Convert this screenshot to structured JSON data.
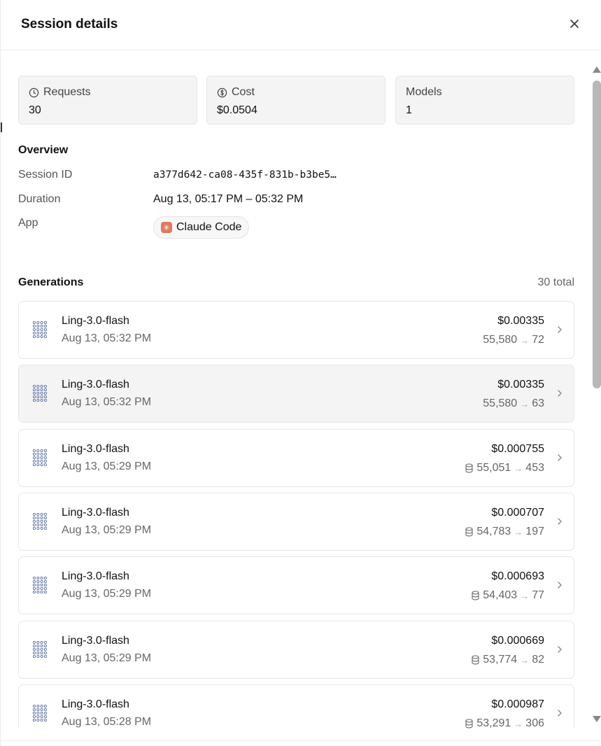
{
  "header": {
    "title": "Session details"
  },
  "stats": [
    {
      "label": "Requests",
      "value": "30",
      "icon": "clock-icon"
    },
    {
      "label": "Cost",
      "value": "$0.0504",
      "icon": "dollar-icon"
    },
    {
      "label": "Models",
      "value": "1",
      "icon": ""
    }
  ],
  "overview": {
    "title": "Overview",
    "session_id_label": "Session ID",
    "session_id_value": "a377d642-ca08-435f-831b-b3be5…",
    "duration_label": "Duration",
    "duration_value": "Aug 13, 05:17 PM – 05:32 PM",
    "app_label": "App",
    "app_value": "Claude Code"
  },
  "generations": {
    "title": "Generations",
    "total": "30 total",
    "items": [
      {
        "model": "Ling-3.0-flash",
        "time": "Aug 13, 05:32 PM",
        "cost": "$0.00335",
        "input": "55,580",
        "output": "72",
        "cached": false
      },
      {
        "model": "Ling-3.0-flash",
        "time": "Aug 13, 05:32 PM",
        "cost": "$0.00335",
        "input": "55,580",
        "output": "63",
        "cached": false
      },
      {
        "model": "Ling-3.0-flash",
        "time": "Aug 13, 05:29 PM",
        "cost": "$0.000755",
        "input": "55,051",
        "output": "453",
        "cached": true
      },
      {
        "model": "Ling-3.0-flash",
        "time": "Aug 13, 05:29 PM",
        "cost": "$0.000707",
        "input": "54,783",
        "output": "197",
        "cached": true
      },
      {
        "model": "Ling-3.0-flash",
        "time": "Aug 13, 05:29 PM",
        "cost": "$0.000693",
        "input": "54,403",
        "output": "77",
        "cached": true
      },
      {
        "model": "Ling-3.0-flash",
        "time": "Aug 13, 05:29 PM",
        "cost": "$0.000669",
        "input": "53,774",
        "output": "82",
        "cached": true
      },
      {
        "model": "Ling-3.0-flash",
        "time": "Aug 13, 05:28 PM",
        "cost": "$0.000987",
        "input": "53,291",
        "output": "306",
        "cached": true
      }
    ]
  },
  "colors": {
    "app_logo": "#e07a5f",
    "model_icon": "#5b6f9e"
  }
}
